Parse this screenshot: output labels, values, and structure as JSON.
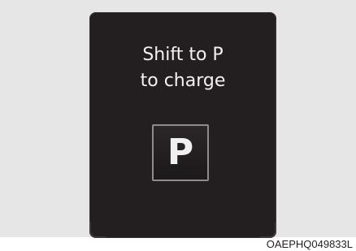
{
  "display": {
    "message_line1": "Shift to P",
    "message_line2": "to charge",
    "gear_indicator": "P"
  },
  "figure_code": "OAEPHQ049833L",
  "colors": {
    "display_background": "#231f20",
    "text": "#f2f2f2",
    "page_background": "#e6e6e6"
  }
}
